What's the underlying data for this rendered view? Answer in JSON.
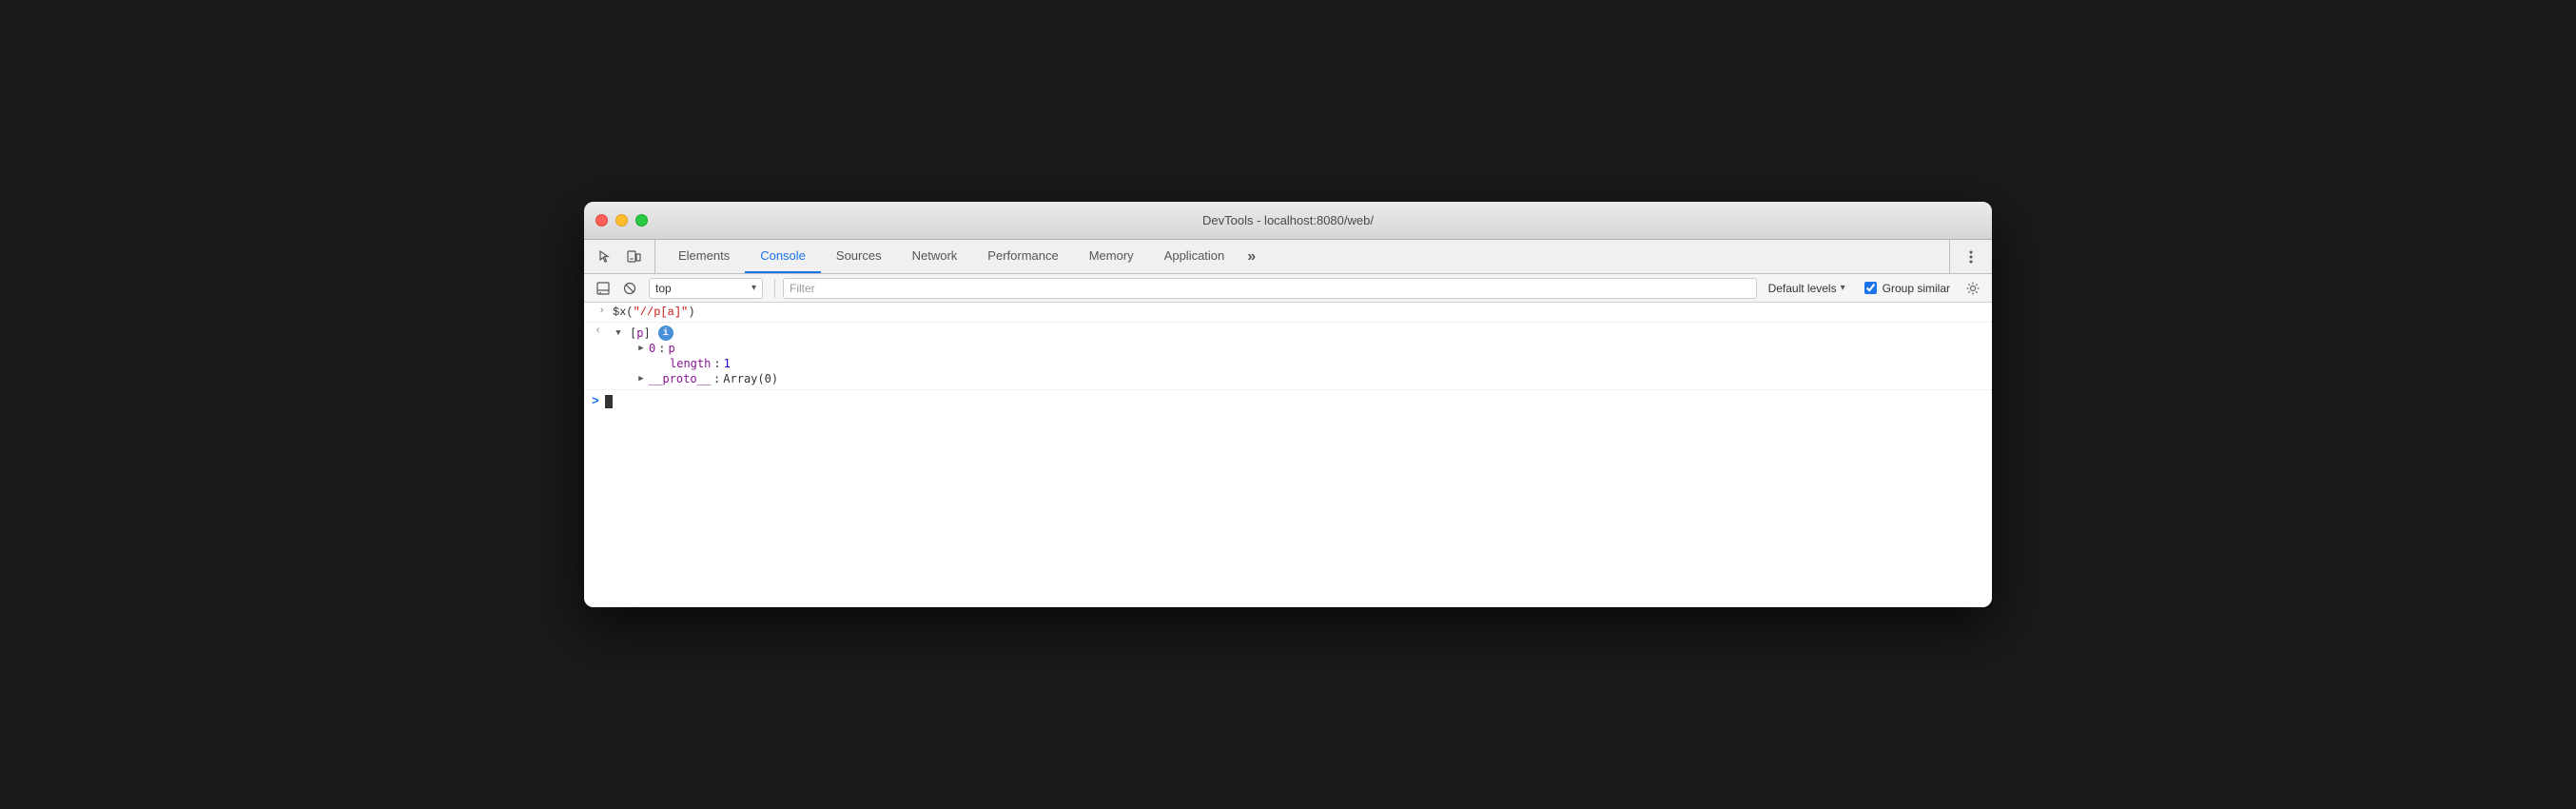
{
  "window": {
    "title": "DevTools - localhost:8080/web/"
  },
  "tabs": {
    "items": [
      {
        "id": "elements",
        "label": "Elements",
        "active": false
      },
      {
        "id": "console",
        "label": "Console",
        "active": true
      },
      {
        "id": "sources",
        "label": "Sources",
        "active": false
      },
      {
        "id": "network",
        "label": "Network",
        "active": false
      },
      {
        "id": "performance",
        "label": "Performance",
        "active": false
      },
      {
        "id": "memory",
        "label": "Memory",
        "active": false
      },
      {
        "id": "application",
        "label": "Application",
        "active": false
      }
    ],
    "overflow_label": "»"
  },
  "console_toolbar": {
    "context_label": "top",
    "context_arrow": "▾",
    "filter_placeholder": "Filter",
    "default_levels_label": "Default levels",
    "default_levels_arrow": "▾",
    "group_similar_label": "Group similar",
    "group_similar_checked": true
  },
  "console_output": {
    "entries": [
      {
        "type": "input",
        "chevron": ">",
        "text": "$x(\"//p[a]\")"
      },
      {
        "type": "output_array",
        "back_arrow": "←",
        "expand_state": "expanded",
        "array_label": "[p]",
        "has_info_badge": true,
        "children": [
          {
            "type": "object_prop",
            "expand_state": "collapsed",
            "key": "0",
            "value": "p",
            "value_color": "element"
          },
          {
            "type": "plain_prop",
            "key": "length",
            "value": "1",
            "value_color": "number"
          },
          {
            "type": "object_prop",
            "expand_state": "collapsed",
            "key": "__proto__",
            "value": "Array(0)",
            "value_color": "plain"
          }
        ]
      }
    ],
    "prompt_symbol": ">",
    "cursor_visible": true
  }
}
